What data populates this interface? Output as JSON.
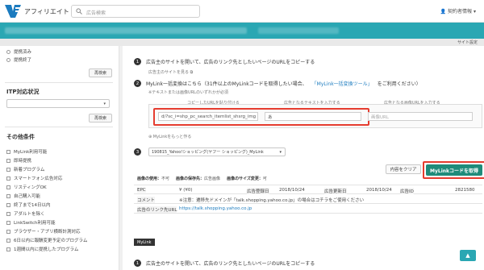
{
  "header": {
    "brand": "アフィリエイト",
    "search_placeholder": "広告検索",
    "user_label": "契約者情報"
  },
  "subbar": {
    "site_setting": "サイト設定"
  },
  "sidebar": {
    "radios": [
      "提携済み",
      "提携終了"
    ],
    "search_button": "再検索",
    "itp_title": "ITP対応状況",
    "other_title": "その他条件",
    "checks": [
      "MyLink利用可能",
      "即時提携",
      "新着プログラム",
      "スマートフォン広告対応",
      "リスティングOK",
      "自己購入可能",
      "終了まで14日以内",
      "アダルトを除く",
      "LinkSwitch利用可能",
      "ブラウザー・アプリ横断計測対応",
      "6日以内に報酬変更予定のプログラム",
      "1週間以内に提携したプログラム"
    ]
  },
  "main": {
    "step1": "広告主のサイトを開いて、広告のリンク先としたいページのURLをコピーする",
    "step1_link": "広告主のサイトを見る",
    "step2_a": "MyLink一括変換はこちら（31件以上のMyLinkコードを取得したい場合、",
    "step2_link": "「MyLink一括変換ツール」",
    "step2_b": "をご利用ください）",
    "step2_note": "※テキストまたは画像URLのいずれかが必須",
    "col_url": "コピーしたURLを貼り付ける",
    "col_text": "広告となるテキストを入力する",
    "col_image": "広告となる画像URLを入力する",
    "url_value": "d/?sc_i=shp_pc_search_itemlist_shsrg_img",
    "text_value": "あ",
    "image_placeholder": "画像URL",
    "more_link": "MyLinkをもっと作る",
    "dropdown": "190815_Yahoo!ショッピング(ヤフー ショッピング)_MyLink",
    "clear_button": "内容をクリア",
    "get_button": "MyLinkコードを取得",
    "meta": {
      "use_label": "画像の使用：",
      "use_value": "不可",
      "save_label": "画像の保存先：",
      "save_value": "広告画像",
      "size_label": "画像のサイズ変更：",
      "size_value": "可"
    },
    "info": {
      "epc_label": "EPC",
      "epc_value": "¥ (¥0)",
      "reg_label": "広告登録日",
      "reg_value": "2018/10/24",
      "upd_label": "広告更新日",
      "upd_value": "2018/10/24",
      "id_label": "広告ID",
      "id_value": "2821580",
      "comment_label": "コメント",
      "comment_value": "※注意：遷移先ドメインが「talk.shopping.yahoo.co.jp」の場合はコチラをご使用ください",
      "link_label": "広告のリンク先URL",
      "link_value": "https://talk.shopping.yahoo.co.jp"
    },
    "tag": "MyLink",
    "step1b": "広告主のサイトを開いて、広告のリンク先としたいページのURLをコピーする"
  },
  "colors": {
    "teal": "#2aa7b3",
    "button": "#1f8b7a",
    "highlight": "#e53c2f"
  }
}
